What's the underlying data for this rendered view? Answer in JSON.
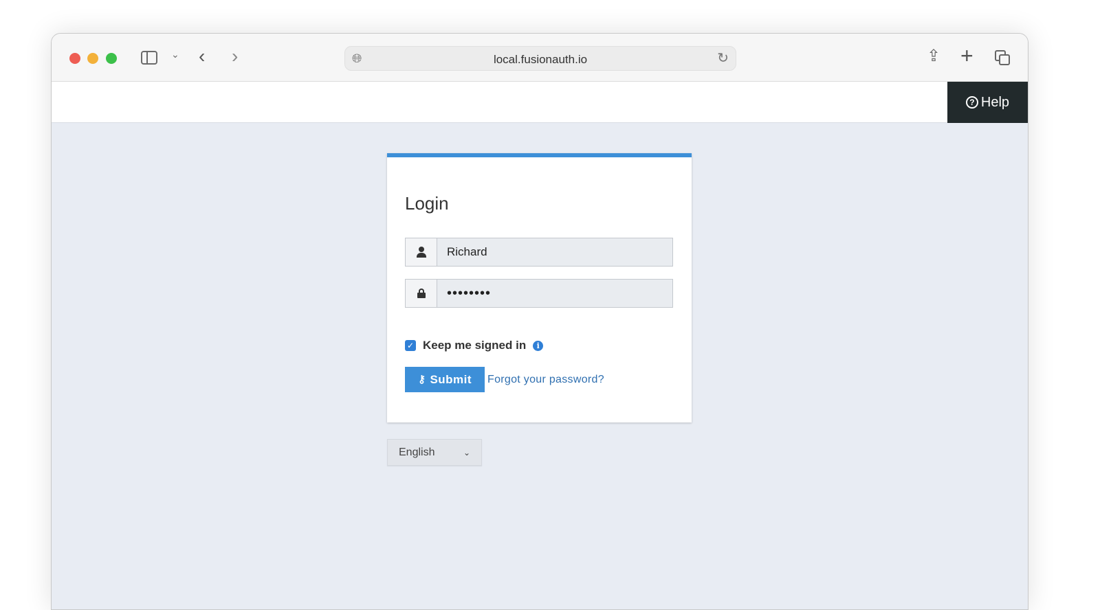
{
  "browser": {
    "url": "local.fusionauth.io",
    "icons": {
      "sidebar": "sidebar-icon",
      "back": "chevron-left-icon",
      "forward": "chevron-right-icon",
      "globe": "globe-icon",
      "reload": "reload-icon",
      "share": "share-icon",
      "new_tab": "plus-icon",
      "tabs": "tabs-icon"
    }
  },
  "header": {
    "help_label": "Help"
  },
  "login": {
    "title": "Login",
    "username_value": "Richard",
    "password_value": "••••••••",
    "keep_signed_in_label": "Keep me signed in",
    "keep_signed_in_checked": true,
    "submit_label": "Submit",
    "forgot_password_label": "Forgot your password?"
  },
  "language": {
    "selected": "English"
  },
  "colors": {
    "accent": "#3d8fd8",
    "header_dark": "#222a2c",
    "page_bg": "#e8ecf3",
    "link": "#2f6fb0"
  }
}
